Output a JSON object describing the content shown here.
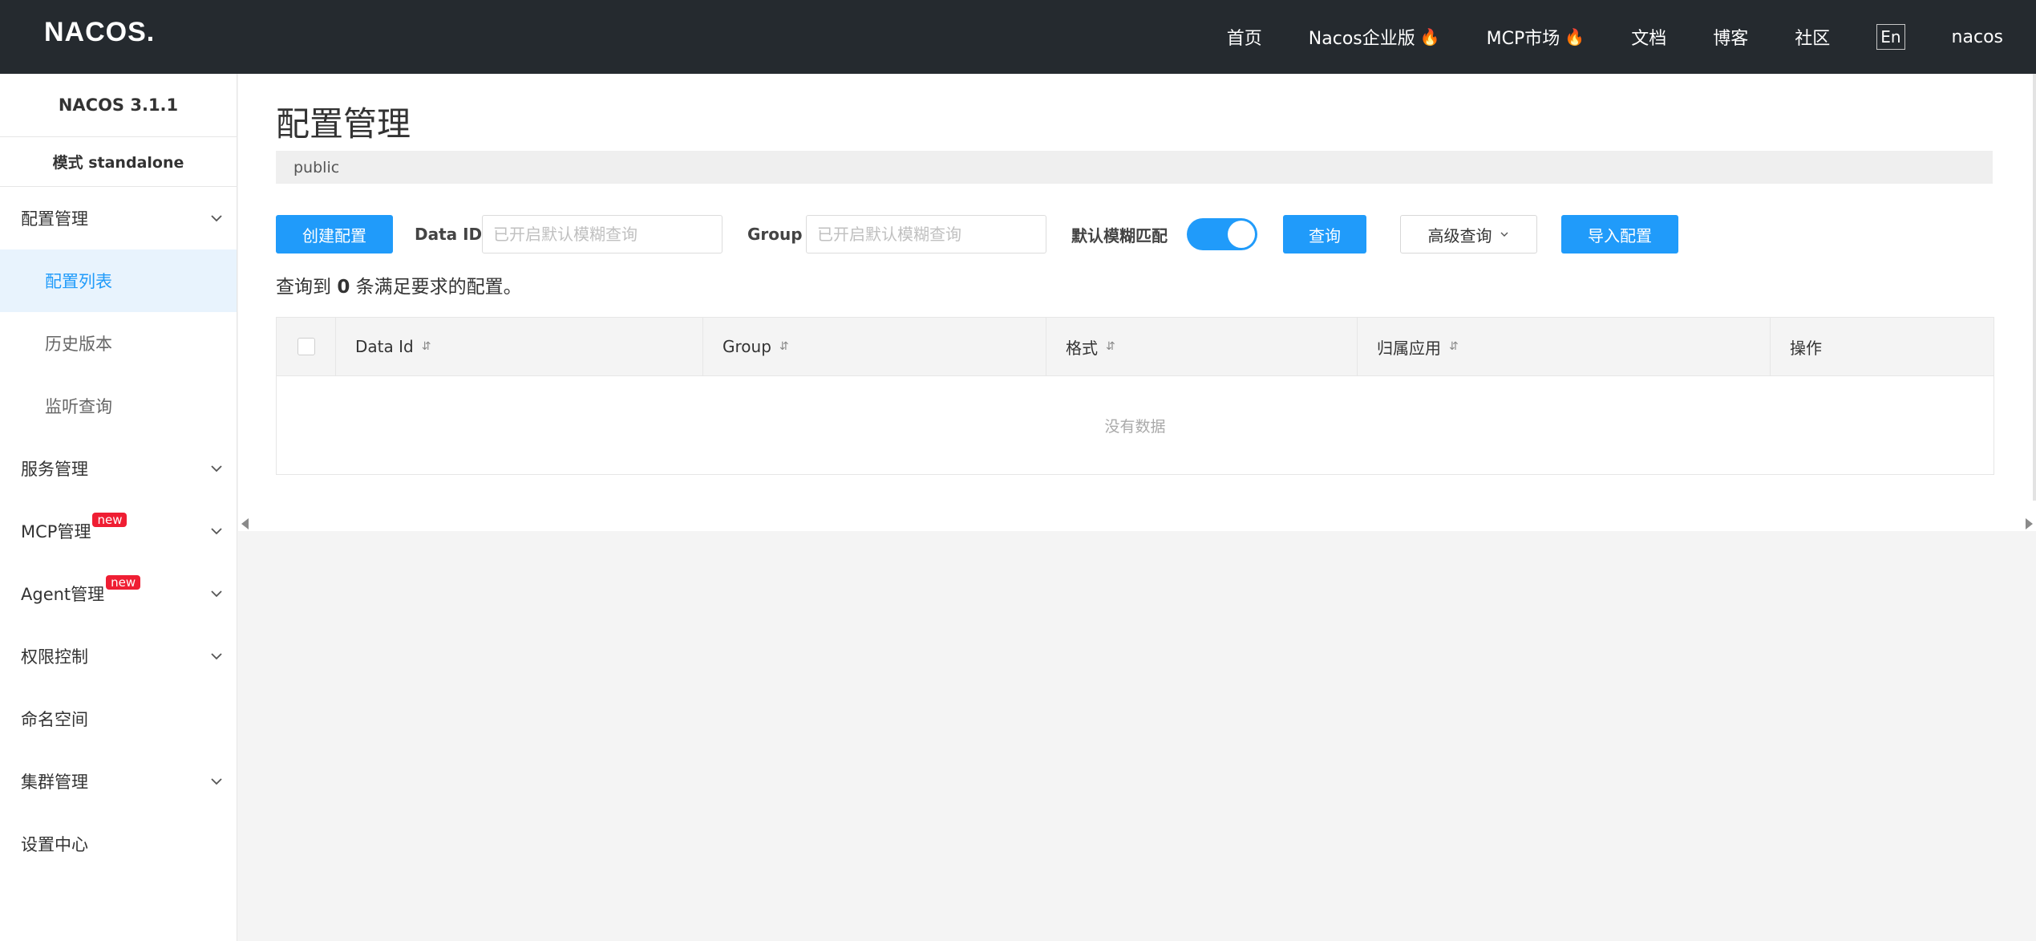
{
  "header": {
    "logo_text": "NACOS.",
    "nav": [
      {
        "label": "首页",
        "hot": false
      },
      {
        "label": "Nacos企业版",
        "hot": true
      },
      {
        "label": "MCP市场",
        "hot": true
      },
      {
        "label": "文档",
        "hot": false
      },
      {
        "label": "博客",
        "hot": false
      },
      {
        "label": "社区",
        "hot": false
      }
    ],
    "lang_label": "En",
    "user": "nacos"
  },
  "sidebar": {
    "version": "NACOS 3.1.1",
    "mode": "模式 standalone",
    "items": [
      {
        "label": "配置管理",
        "expandable": true
      },
      {
        "label": "配置列表"
      },
      {
        "label": "历史版本"
      },
      {
        "label": "监听查询"
      },
      {
        "label": "服务管理",
        "expandable": true
      },
      {
        "label": "MCP管理",
        "badge": "new",
        "expandable": true
      },
      {
        "label": "Agent管理",
        "badge": "new",
        "expandable": true
      },
      {
        "label": "权限控制",
        "expandable": true
      },
      {
        "label": "命名空间"
      },
      {
        "label": "集群管理",
        "expandable": true
      },
      {
        "label": "设置中心"
      }
    ]
  },
  "main": {
    "title": "配置管理",
    "namespace": "public",
    "toolbar": {
      "create_label": "创建配置",
      "dataid_label": "Data ID",
      "dataid_placeholder": "已开启默认模糊查询",
      "group_label": "Group",
      "group_placeholder": "已开启默认模糊查询",
      "fuzzy_label": "默认模糊匹配",
      "fuzzy_on": true,
      "query_label": "查询",
      "advanced_label": "高级查询",
      "import_label": "导入配置"
    },
    "result": {
      "prefix": "查询到",
      "count": "0",
      "suffix": "条满足要求的配置。"
    },
    "table": {
      "columns": [
        "Data Id",
        "Group",
        "格式",
        "归属应用",
        "操作"
      ],
      "empty_text": "没有数据"
    }
  },
  "colors": {
    "accent": "#209bfa",
    "header_bg": "#252a2f",
    "hot": "#e0262d",
    "badge": "#ef1e33"
  }
}
